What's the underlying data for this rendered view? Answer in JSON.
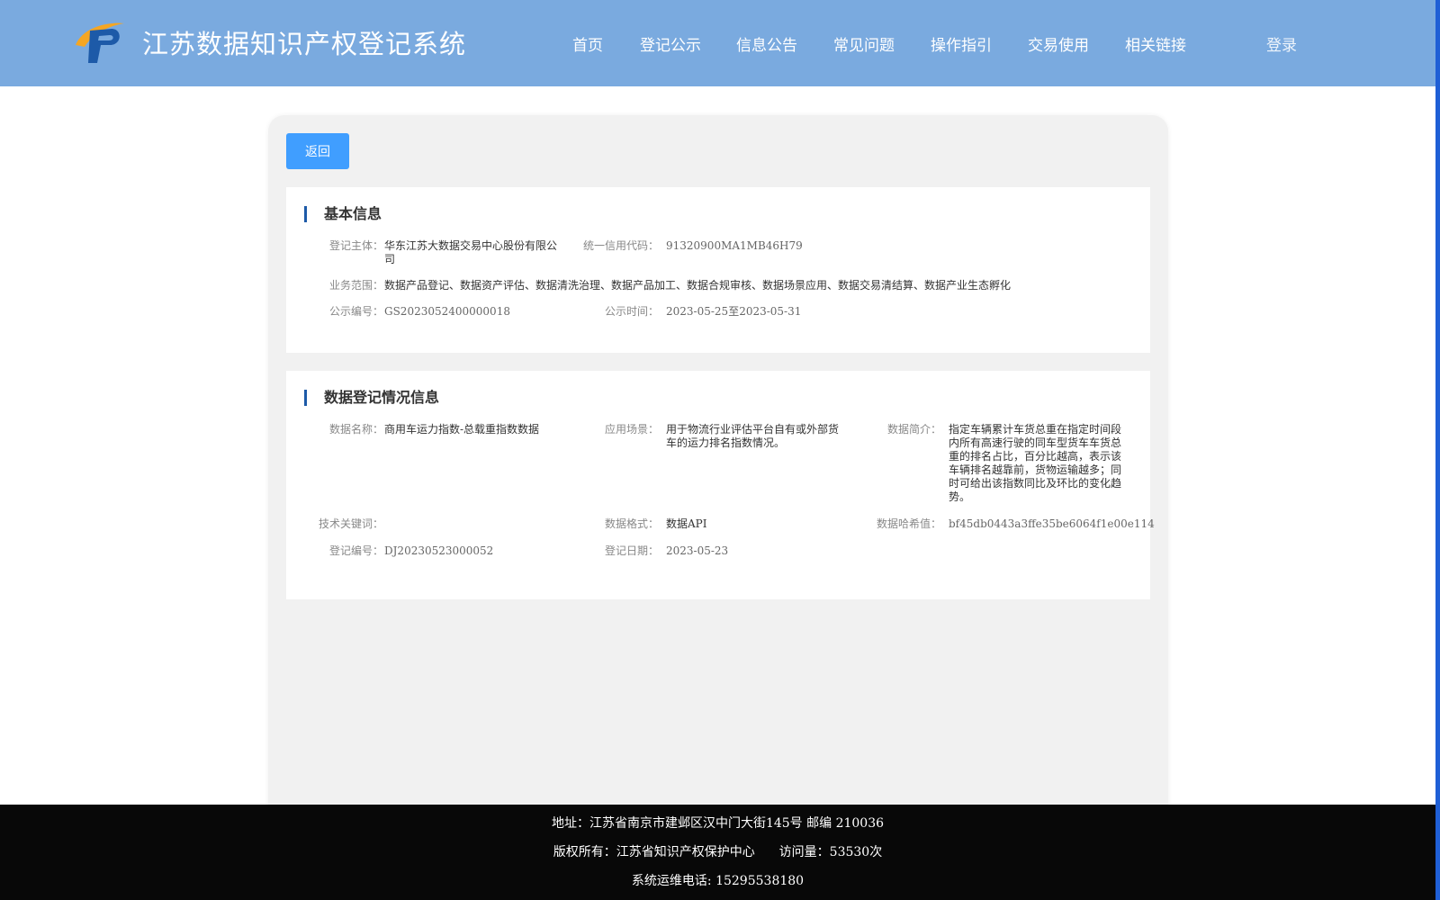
{
  "header": {
    "site_title": "江苏数据知识产权登记系统",
    "logo_icon": "ip-logo-icon",
    "nav": [
      "首页",
      "登记公示",
      "信息公告",
      "常见问题",
      "操作指引",
      "交易使用",
      "相关链接"
    ],
    "login": "登录",
    "colors": {
      "header_bg": "#7aaadf",
      "accent": "#409eff",
      "title_bar": "#1d5aa8"
    }
  },
  "actions": {
    "back": "返回"
  },
  "basic_info": {
    "title": "基本信息",
    "entity_label": "登记主体：",
    "entity_value_1": "华东江苏大数据交易中心股份有限公",
    "entity_value_2": "司",
    "credit_label": "统一信用代码：",
    "credit_value": "91320900MA1MB46H79",
    "scope_label": "业务范围：",
    "scope_value": "数据产品登记、数据资产评估、数据清洗治理、数据产品加工、数据合规审核、数据场景应用、数据交易清结算、数据产业生态孵化",
    "notice_no_label": "公示编号：",
    "notice_no_value": "GS2023052400000018",
    "notice_time_label": "公示时间：",
    "notice_time_value": "2023-05-25至2023-05-31"
  },
  "registration_info": {
    "title": "数据登记情况信息",
    "name_label": "数据名称：",
    "name_value": "商用车运力指数-总载重指数数据",
    "scene_label": "应用场景：",
    "scene_value_1": "用于物流行业评估平台自有或外部货",
    "scene_value_2": "车的运力排名指数情况。",
    "intro_label": "数据简介：",
    "intro_lines": [
      "指定车辆累计车货总重在指定时间段",
      "内所有高速行驶的同车型货车车货总",
      "重的排名占比，百分比越高，表示该",
      "车辆排名越靠前，货物运输越多；同",
      "时可给出该指数同比及环比的变化趋",
      "势。"
    ],
    "keywords_label": "技术关键词：",
    "format_label": "数据格式：",
    "format_value": "数据API",
    "hash_label": "数据哈希值：",
    "hash_value": "bf45db0443a3ffe35be6064f1e00e114",
    "reg_no_label": "登记编号：",
    "reg_no_value": "DJ20230523000052",
    "reg_date_label": "登记日期：",
    "reg_date_value": "2023-05-23"
  },
  "footer": {
    "address": "地址：江苏省南京市建邺区汉中门大街145号 邮编 210036",
    "copyright": "版权所有：江苏省知识产权保护中心",
    "visits": "访问量：53530次",
    "phone": "系统运维电话: 15295538180"
  }
}
